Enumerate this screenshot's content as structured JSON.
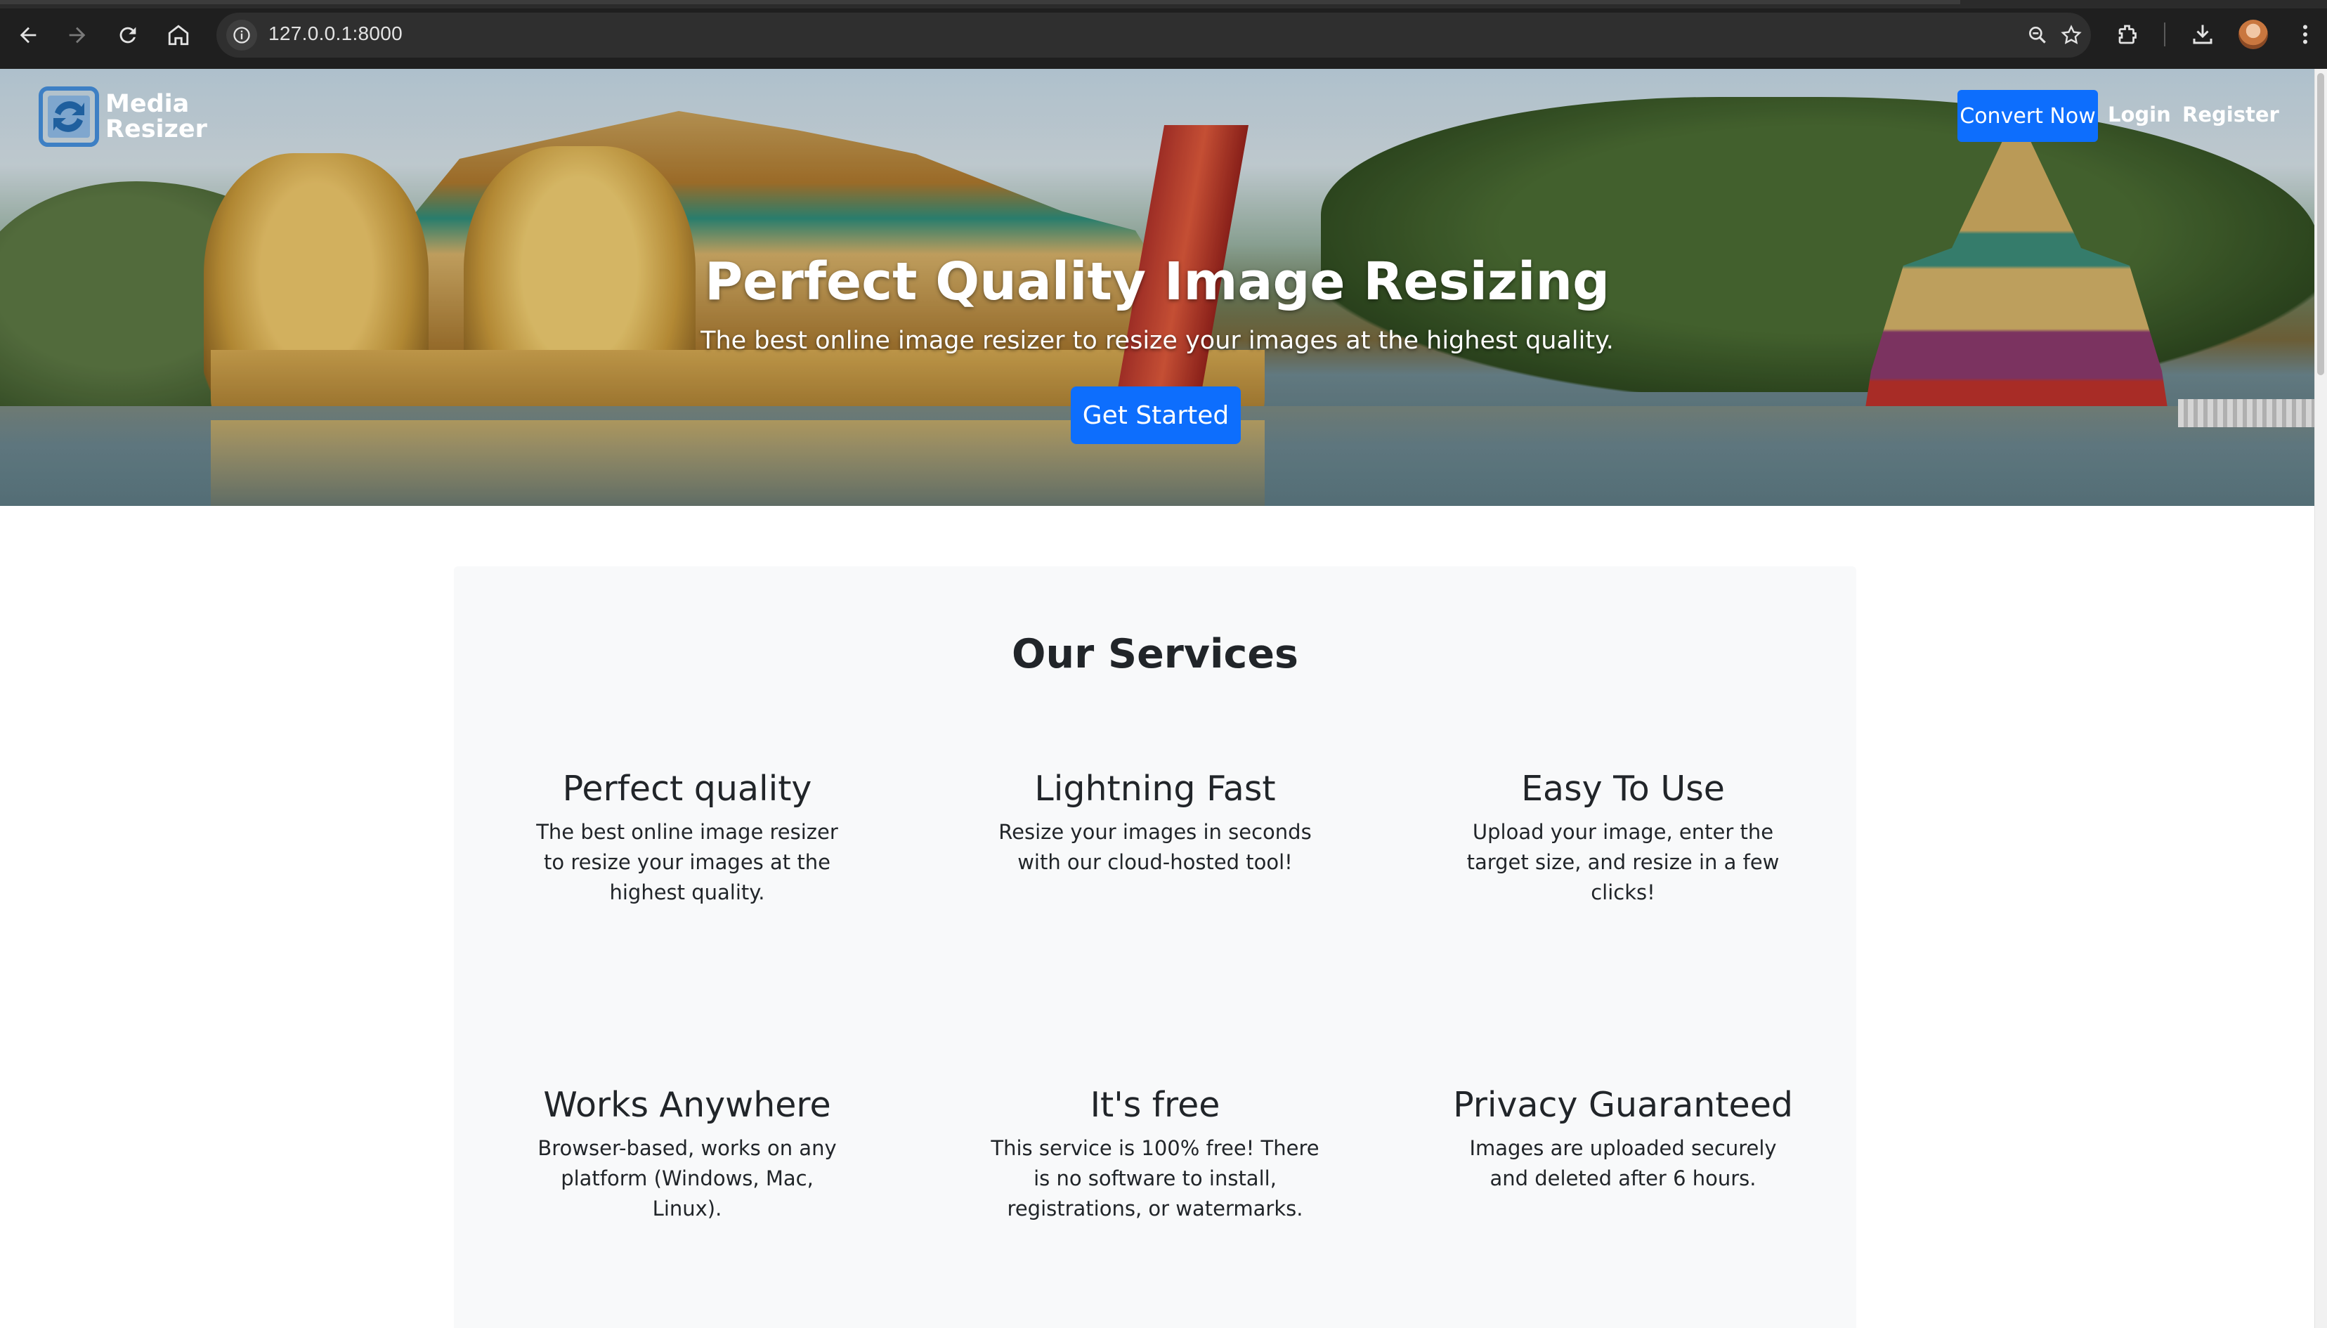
{
  "browser": {
    "url": "127.0.0.1:8000",
    "icons": [
      "back-icon",
      "forward-icon",
      "reload-icon",
      "home-icon",
      "site-info-icon",
      "zoom-icon",
      "bookmark-star-icon",
      "extensions-icon",
      "download-icon",
      "avatar",
      "menu-icon"
    ]
  },
  "nav": {
    "brand_line1": "Media",
    "brand_line2": "Resizer",
    "convert_label": "Convert Now",
    "login_label": "Login",
    "register_label": "Register"
  },
  "hero": {
    "title": "Perfect Quality Image Resizing",
    "subtitle": "The best online image resizer to resize your images at the highest quality.",
    "cta_label": "Get Started"
  },
  "services": {
    "title": "Our Services",
    "items": [
      {
        "title": "Perfect quality",
        "text": "The best online image resizer to resize your images at the highest quality."
      },
      {
        "title": "Lightning Fast",
        "text": "Resize your images in seconds with our cloud-hosted tool!"
      },
      {
        "title": "Easy To Use",
        "text": "Upload your image, enter the target size, and resize in a few clicks!"
      },
      {
        "title": "Works Anywhere",
        "text": "Browser-based, works on any platform (Windows, Mac, Linux)."
      },
      {
        "title": "It's free",
        "text": "This service is 100% free! There is no software to install, registrations, or watermarks."
      },
      {
        "title": "Privacy Guaranteed",
        "text": "Images are uploaded securely and deleted after 6 hours."
      }
    ]
  },
  "colors": {
    "primary": "#0d6efd",
    "chrome_bg": "#1f1f1f",
    "section_bg": "#f8f9fa",
    "text": "#212529"
  }
}
